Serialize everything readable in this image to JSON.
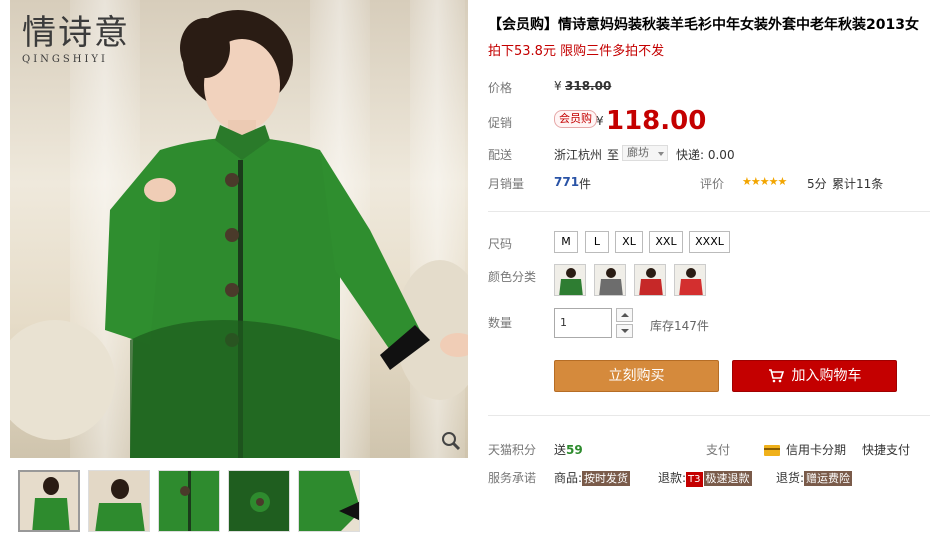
{
  "brand": {
    "name_cn": "情诗意",
    "name_en": "QINGSHIYI"
  },
  "product": {
    "title": "【会员购】情诗意妈妈装秋装羊毛衫中年女装外套中老年秋装2013女",
    "promo": "拍下53.8元 限购三件多拍不发"
  },
  "price": {
    "label": "价格",
    "currency": "¥",
    "original": "318.00",
    "promo_label": "促销",
    "member_tag": "会员购",
    "current": "118.00"
  },
  "shipping": {
    "label": "配送",
    "origin": "浙江杭州",
    "to": "至",
    "destination": "廊坊",
    "fee": "快递: 0.00"
  },
  "sales": {
    "label": "月销量",
    "count": "771",
    "unit": "件",
    "rating_label": "评价",
    "stars": "★★★★★",
    "score": "5分",
    "reviews": "累计11条"
  },
  "size": {
    "label": "尺码",
    "options": [
      "M",
      "L",
      "XL",
      "XXL",
      "XXXL"
    ]
  },
  "color": {
    "label": "颜色分类",
    "options": [
      "green",
      "gray",
      "red",
      "red-orange"
    ],
    "colors": [
      "#2e7d32",
      "#6d6d6d",
      "#c62828",
      "#d32f2f"
    ]
  },
  "quantity": {
    "label": "数量",
    "value": "1",
    "stock": "库存147件"
  },
  "actions": {
    "buy_now": "立刻购买",
    "add_to_cart": "加入购物车"
  },
  "points": {
    "label": "天猫积分",
    "prefix": "送",
    "value": "59",
    "pay_label": "支付",
    "credit": "信用卡分期",
    "quick_pay": "快捷支付"
  },
  "service": {
    "label": "服务承诺",
    "goods_label": "商品:",
    "goods_tag": "按时发货",
    "refund_label": "退款:",
    "refund_t3": "T3",
    "refund_tag": "极速退款",
    "return_label": "退货:",
    "return_tag": "赠运费险"
  },
  "colors": {
    "accent_red": "#c40000",
    "buy_orange": "#d58a3c",
    "garment_green": "#2e8b2e"
  },
  "icons": [
    "zoom-icon",
    "cart-icon",
    "credit-card-icon",
    "chevron-down-icon",
    "increment-icon",
    "decrement-icon"
  ]
}
